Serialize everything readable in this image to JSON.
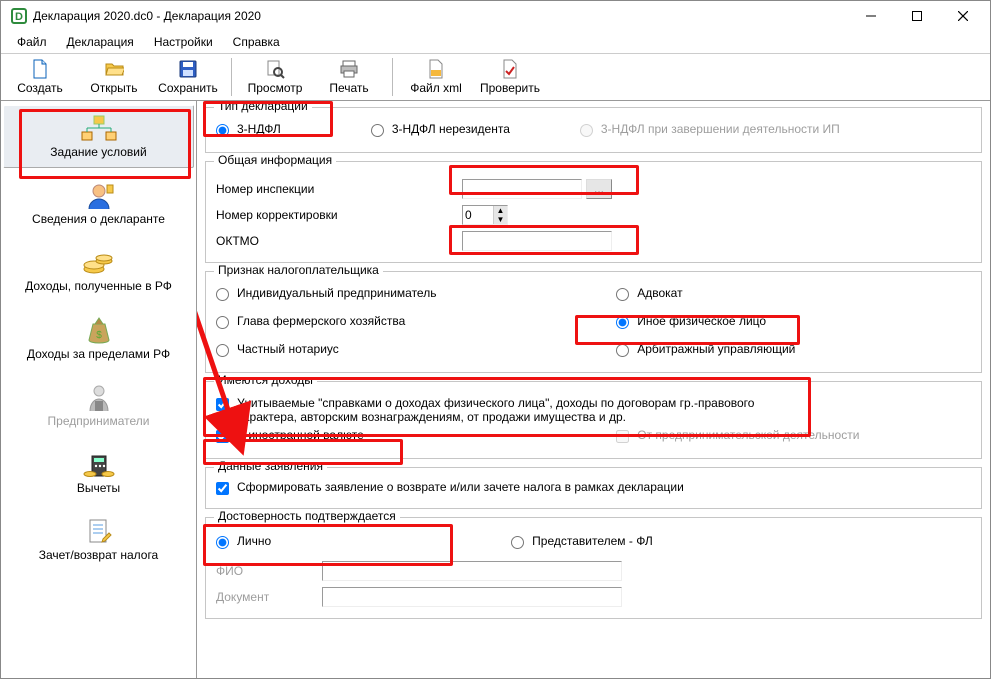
{
  "window": {
    "title": "Декларация 2020.dc0 - Декларация 2020"
  },
  "menu": {
    "file": "Файл",
    "declaration": "Декларация",
    "settings": "Настройки",
    "help": "Справка"
  },
  "toolbar": {
    "new": "Создать",
    "open": "Открыть",
    "save": "Сохранить",
    "preview": "Просмотр",
    "print": "Печать",
    "xml": "Файл xml",
    "check": "Проверить"
  },
  "nav": {
    "conditions": "Задание условий",
    "declarant": "Сведения о декларанте",
    "income_rf": "Доходы, полученные в РФ",
    "income_abroad": "Доходы за пределами РФ",
    "entrepreneurs": "Предприниматели",
    "deductions": "Вычеты",
    "offset": "Зачет/возврат налога"
  },
  "groups": {
    "decl_type": "Тип декларации",
    "general_info": "Общая информация",
    "taxpayer_sign": "Признак налогоплательщика",
    "have_income": "Имеются доходы",
    "statement_data": "Данные заявления",
    "authenticity": "Достоверность подтверждается"
  },
  "decl_type": {
    "ndfl3": "3-НДФЛ",
    "nonresident": "3-НДФЛ нерезидента",
    "ip_end": "3-НДФЛ при завершении деятельности ИП"
  },
  "general": {
    "inspection_no": "Номер инспекции",
    "correction_no": "Номер корректировки",
    "oktmo": "ОКТМО",
    "inspection_val": "",
    "correction_val": "0",
    "oktmo_val": "",
    "dots": "..."
  },
  "taxpayer": {
    "individual_entrepreneur": "Индивидуальный предприниматель",
    "farm_head": "Глава фермерского хозяйства",
    "private_notary": "Частный нотариус",
    "advocate": "Адвокат",
    "other_individual": "Иное физическое лицо",
    "arbitration_manager": "Арбитражный управляющий"
  },
  "income": {
    "accounted": "Учитываемые \"справками о доходах физического лица\", доходы по договорам гр.-правового характера, авторским вознаграждениям, от продажи имущества и др.",
    "foreign_currency": "В иностранной валюте",
    "entrepreneur_activity": "От предпринимательской деятельности"
  },
  "statement": {
    "form_refund": "Сформировать заявление о  возврате и/или зачете налога в рамках декларации"
  },
  "auth": {
    "personally": "Лично",
    "representative": "Представителем - ФЛ",
    "fio": "ФИО",
    "document": "Документ"
  }
}
